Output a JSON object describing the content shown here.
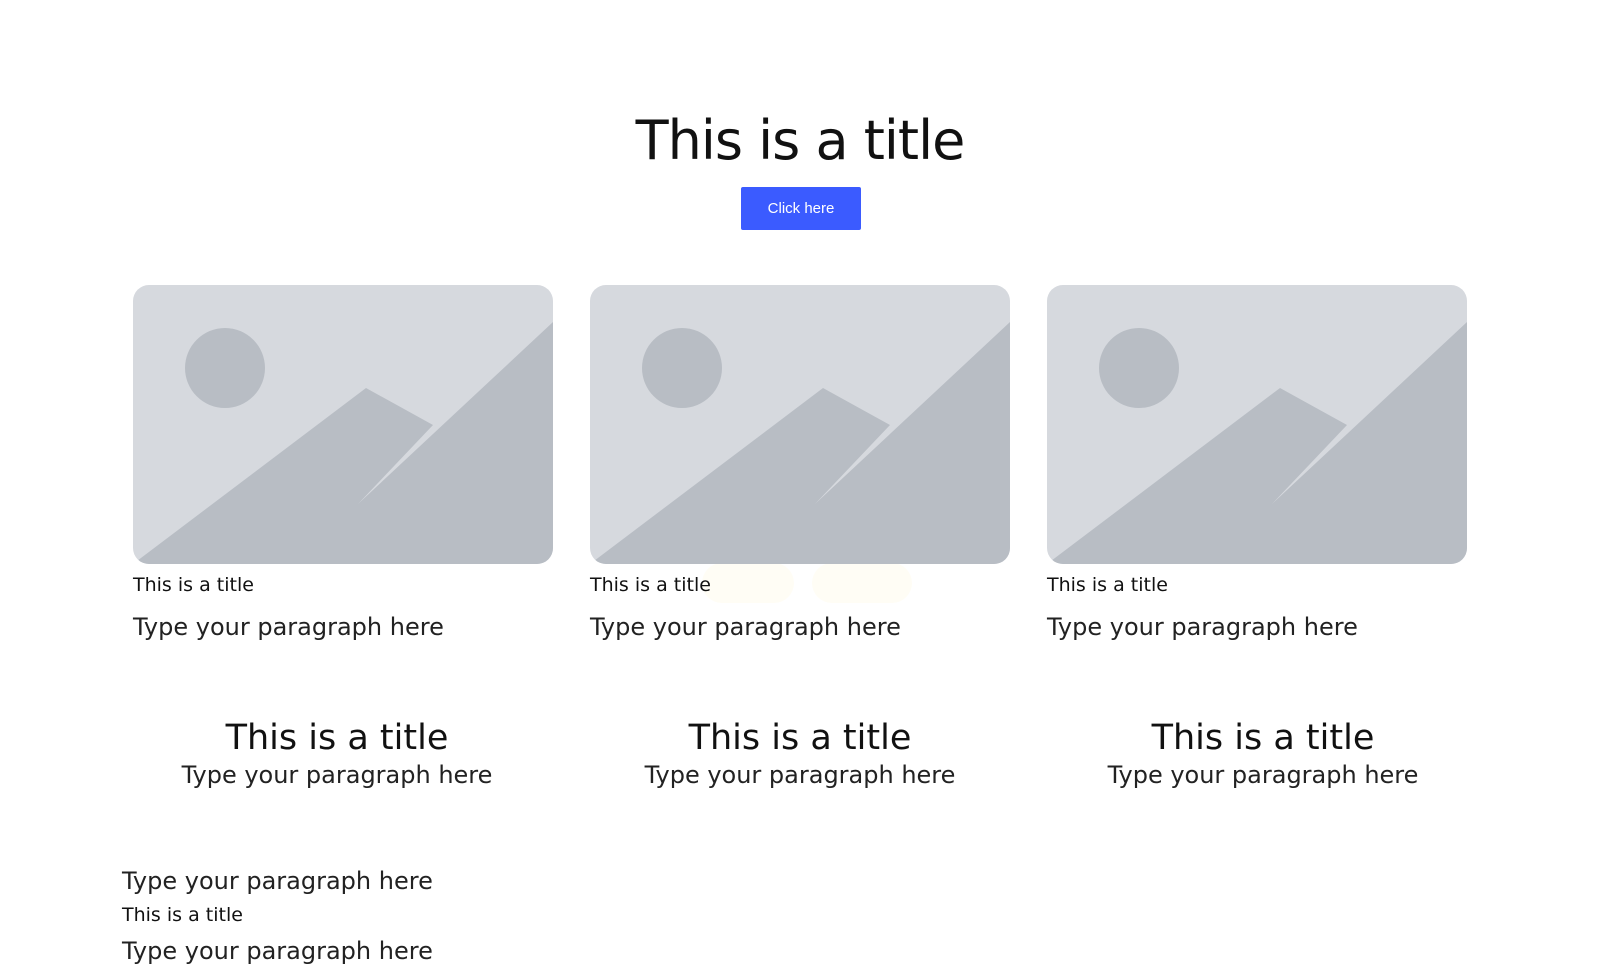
{
  "hero": {
    "title": "This is a title",
    "button_label": "Click here"
  },
  "cards": [
    {
      "title": "This is a title",
      "text": "Type your paragraph here"
    },
    {
      "title": "This is a title",
      "text": "Type your paragraph here"
    },
    {
      "title": "This is a title",
      "text": "Type your paragraph here"
    }
  ],
  "features": [
    {
      "title": "This is a title",
      "text": "Type your paragraph here"
    },
    {
      "title": "This is a title",
      "text": "Type your paragraph here"
    },
    {
      "title": "This is a title",
      "text": "Type your paragraph here"
    }
  ],
  "footer": {
    "text_top": "Type your paragraph here",
    "title": "This is a title",
    "text_bottom": "Type your paragraph here"
  },
  "colors": {
    "accent": "#3b5bff",
    "placeholder_bg": "#d6d9de",
    "placeholder_shape": "#b8bdc4"
  },
  "icons": {
    "card_image": "image-placeholder-icon"
  }
}
